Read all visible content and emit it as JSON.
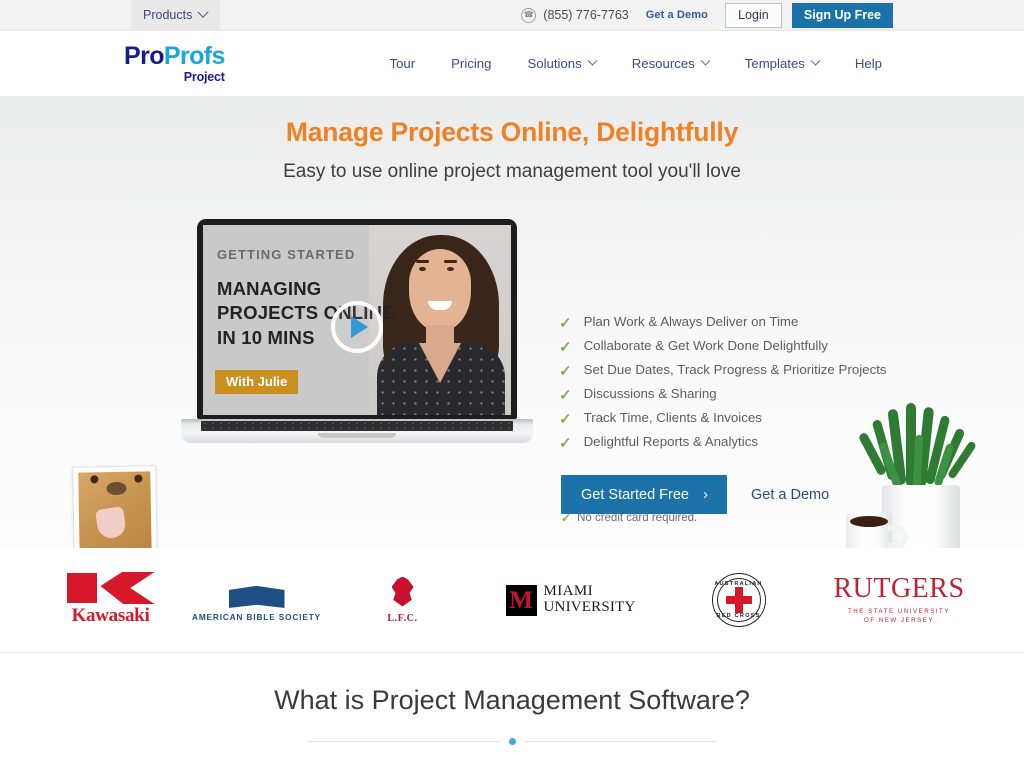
{
  "topbar": {
    "products_label": "Products",
    "products_caret_icon": "chevron-down-icon",
    "phone": "(855) 776-7763",
    "phone_icon": "phone-icon",
    "demo_label": "Get a Demo",
    "login_label": "Login",
    "signup_label": "Sign Up Free",
    "signup_color": "#1a72a8"
  },
  "brand": {
    "pro": "Pro",
    "profs": "Profs",
    "product": "Project",
    "pro_color": "#1a1b8c",
    "profs_color": "#19a5e0"
  },
  "nav": {
    "items": [
      {
        "label": "Tour",
        "has_caret": false
      },
      {
        "label": "Pricing",
        "has_caret": false
      },
      {
        "label": "Solutions",
        "has_caret": true
      },
      {
        "label": "Resources",
        "has_caret": true
      },
      {
        "label": "Templates",
        "has_caret": true
      },
      {
        "label": "Help",
        "has_caret": false
      }
    ]
  },
  "hero": {
    "title": "Manage Projects Online, Delightfully",
    "title_color": "#f08024",
    "subtitle": "Easy to use online project management tool you'll love",
    "bullets": [
      "Plan Work & Always Deliver on Time",
      "Collaborate & Get Work Done Delightfully",
      "Set Due Dates, Track Progress & Prioritize Projects",
      "Discussions & Sharing",
      "Track Time, Clients & Invoices",
      "Delightful Reports & Analytics"
    ],
    "check_icon": "check-icon",
    "check_color": "#7ab648",
    "cta_primary": "Get Started Free",
    "cta_arrow_icon": "chevron-right-icon",
    "cta_secondary": "Get a Demo",
    "cta_note": "No credit card required."
  },
  "video": {
    "eyebrow": "GETTING STARTED",
    "headline": "MANAGING\nPROJECTS ONLINE\nIN 10 MINS",
    "headline_l1": "MANAGING",
    "headline_l2": "PROJECTS ONLINE",
    "headline_l3": "IN 10 MINS",
    "badge": "With Julie",
    "badge_color": "#c8901e",
    "play_icon": "play-button-icon"
  },
  "customer_logos": [
    {
      "name": "Kawasaki",
      "wordmark": "Kawasaki",
      "color": "#d7182a"
    },
    {
      "name": "American Bible Society",
      "wordmark": "AMERICAN BIBLE SOCIETY",
      "color": "#1f4e87"
    },
    {
      "name": "Liverpool FC",
      "wordmark": "L.F.C.",
      "color": "#c8102e"
    },
    {
      "name": "Miami University",
      "mark": "M",
      "line1": "MIAMI",
      "line2": "UNIVERSITY",
      "color": "#c41230"
    },
    {
      "name": "Australian Red Cross",
      "arc_top": "AUSTRALIAN",
      "arc_bottom": "RED CROSS",
      "color": "#d7182a"
    },
    {
      "name": "Rutgers",
      "wordmark": "RUTGERS",
      "sub1": "THE STATE UNIVERSITY",
      "sub2": "OF NEW JERSEY",
      "color": "#b82530"
    }
  ],
  "section": {
    "title": "What is Project Management Software?",
    "divider_dot_color": "#3fa9e5"
  }
}
